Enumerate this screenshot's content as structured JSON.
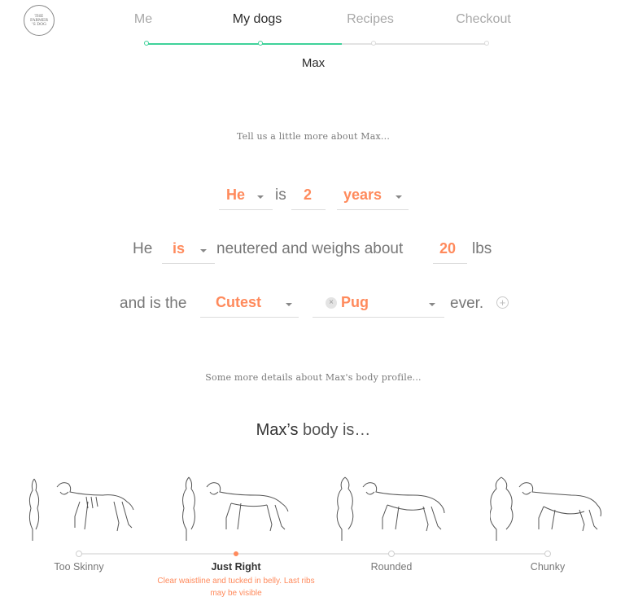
{
  "logo": {
    "text": "THE FARMER'S DOG"
  },
  "nav": {
    "steps": [
      {
        "label": "Me",
        "state": "done"
      },
      {
        "label": "My dogs",
        "state": "active"
      },
      {
        "label": "Recipes",
        "state": "todo"
      },
      {
        "label": "Checkout",
        "state": "todo"
      }
    ],
    "dog_tab": "Max",
    "accent_color": "#3fd29a"
  },
  "intro": "Tell us a little more about Max...",
  "sentence1": {
    "pronoun": "He",
    "is": "is",
    "age": "2",
    "unit": "years"
  },
  "sentence2": {
    "he": "He",
    "neutered": "is",
    "text": "neutered and weighs about",
    "weight": "20",
    "weight_unit": "lbs"
  },
  "sentence3": {
    "prefix": "and is the",
    "adjective": "Cutest",
    "breed": "Pug",
    "suffix": "ever."
  },
  "body_intro": "Some more details about Max's body profile...",
  "body_title": {
    "name": "Max’s",
    "rest": "body is…"
  },
  "body_slider": {
    "options": [
      "Too Skinny",
      "Just Right",
      "Rounded",
      "Chunky"
    ],
    "selected": "Just Right",
    "description": "Clear waistline and tucked in belly. Last ribs may be visible",
    "highlight_color": "#ff8a5c"
  }
}
